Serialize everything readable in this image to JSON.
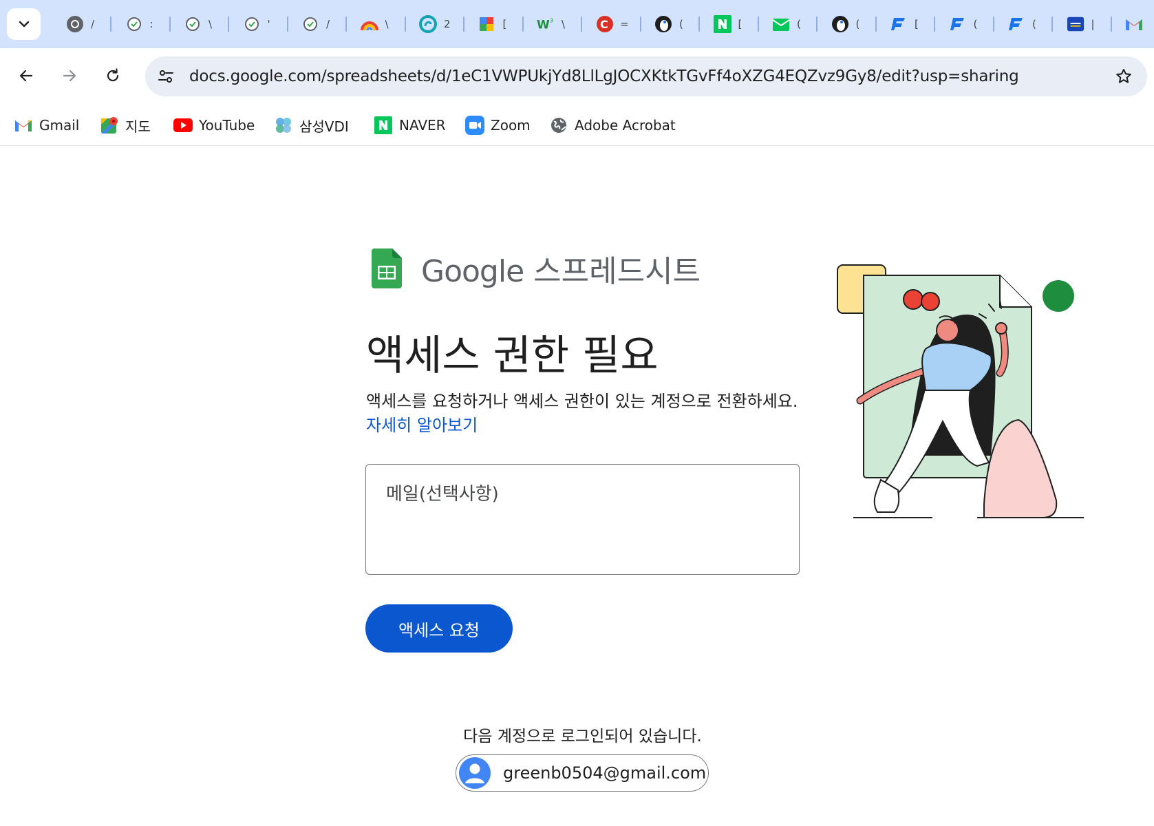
{
  "browser": {
    "tabs": [
      {
        "icon": "chrome-icon",
        "title": "/"
      },
      {
        "icon": "green-check-icon",
        "title": ":"
      },
      {
        "icon": "green-check-icon",
        "title": "\\"
      },
      {
        "icon": "green-check-icon",
        "title": "'"
      },
      {
        "icon": "green-check-icon",
        "title": "/"
      },
      {
        "icon": "rainbow-icon",
        "title": "\\"
      },
      {
        "icon": "teal-swirl-icon",
        "title": "2"
      },
      {
        "icon": "colorful-b-icon",
        "title": "["
      },
      {
        "icon": "w3-icon",
        "title": "\\"
      },
      {
        "icon": "red-c-icon",
        "title": "="
      },
      {
        "icon": "penguin-icon",
        "title": "("
      },
      {
        "icon": "naver-n-icon",
        "title": "["
      },
      {
        "icon": "naver-mail-icon",
        "title": "("
      },
      {
        "icon": "penguin-icon",
        "title": "("
      },
      {
        "icon": "blue-f-icon",
        "title": "["
      },
      {
        "icon": "blue-f-icon",
        "title": "("
      },
      {
        "icon": "blue-f-icon",
        "title": "("
      },
      {
        "icon": "card-icon",
        "title": "|"
      },
      {
        "icon": "gmail-icon",
        "title": ""
      }
    ],
    "url": "docs.google.com/spreadsheets/d/1eC1VWPUkjYd8LlLgJOCXKtkTGvFf4oXZG4EQZvz9Gy8/edit?usp=sharing",
    "bookmarks": [
      {
        "icon": "gmail-icon",
        "label": "Gmail"
      },
      {
        "icon": "maps-icon",
        "label": "지도"
      },
      {
        "icon": "youtube-icon",
        "label": "YouTube"
      },
      {
        "icon": "samsung-vdi-icon",
        "label": "삼성VDI"
      },
      {
        "icon": "naver-icon",
        "label": "NAVER"
      },
      {
        "icon": "zoom-icon",
        "label": "Zoom"
      },
      {
        "icon": "globe-icon",
        "label": "Adobe Acrobat"
      }
    ]
  },
  "page": {
    "brand_google": "Google",
    "brand_product": "스프레드시트",
    "headline": "액세스 권한 필요",
    "description": "액세스를 요청하거나 액세스 권한이 있는 계정으로 전환하세요.",
    "learn_more": "자세히 알아보기",
    "email_placeholder": "메일(선택사항)",
    "request_button": "액세스 요청",
    "signed_in_text": "다음 계정으로 로그인되어 있습니다.",
    "account_email": "greenb0504@gmail.com"
  },
  "colors": {
    "tab_strip": "#d3e3fd",
    "primary_button": "#0b57d0",
    "link": "#0b57d0",
    "sheets_green": "#34a853",
    "avatar": "#4285f4"
  }
}
